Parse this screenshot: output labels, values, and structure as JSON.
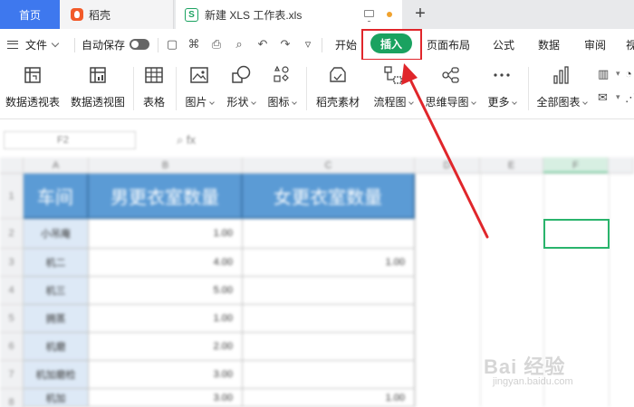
{
  "tabs": {
    "home": "首页",
    "daoke": "稻壳",
    "doc": "新建 XLS 工作表.xls",
    "add": "+"
  },
  "menubar": {
    "file": "文件",
    "autosave": "自动保存",
    "items": [
      "开始",
      "插入",
      "页面布局",
      "公式",
      "数据",
      "审阅",
      "视"
    ],
    "active_item": "插入"
  },
  "ribbon": {
    "items": [
      "数据透视表",
      "数据透视图",
      "表格",
      "图片",
      "形状",
      "图标",
      "稻壳素材",
      "流程图",
      "思维导图",
      "更多",
      "全部图表"
    ]
  },
  "formula": {
    "cell_ref": "F2",
    "fx": "fx"
  },
  "grid": {
    "columns": [
      "A",
      "B",
      "C",
      "D",
      "E",
      "F"
    ],
    "rows": [
      "1",
      "2",
      "3",
      "4",
      "5",
      "6",
      "7",
      "8"
    ],
    "header": [
      "车间",
      "男更衣室数量",
      "女更衣室数量"
    ],
    "data": [
      [
        "小吊庵",
        "1.00",
        ""
      ],
      [
        "机二",
        "4.00",
        "1.00"
      ],
      [
        "机三",
        "5.00",
        ""
      ],
      [
        "拥蒸",
        "1.00",
        ""
      ],
      [
        "机磨",
        "2.00",
        ""
      ],
      [
        "机加磨检",
        "3.00",
        ""
      ],
      [
        "机加",
        "3.00",
        "1.00"
      ]
    ]
  },
  "watermark": {
    "main": "Bai 经验",
    "sub": "jingyan.baidu.com"
  },
  "colors": {
    "accent_green": "#1aa260",
    "home_tab_blue": "#3e78ee",
    "header_blue": "#5b9bd5",
    "annotation_red": "#e0262b"
  }
}
